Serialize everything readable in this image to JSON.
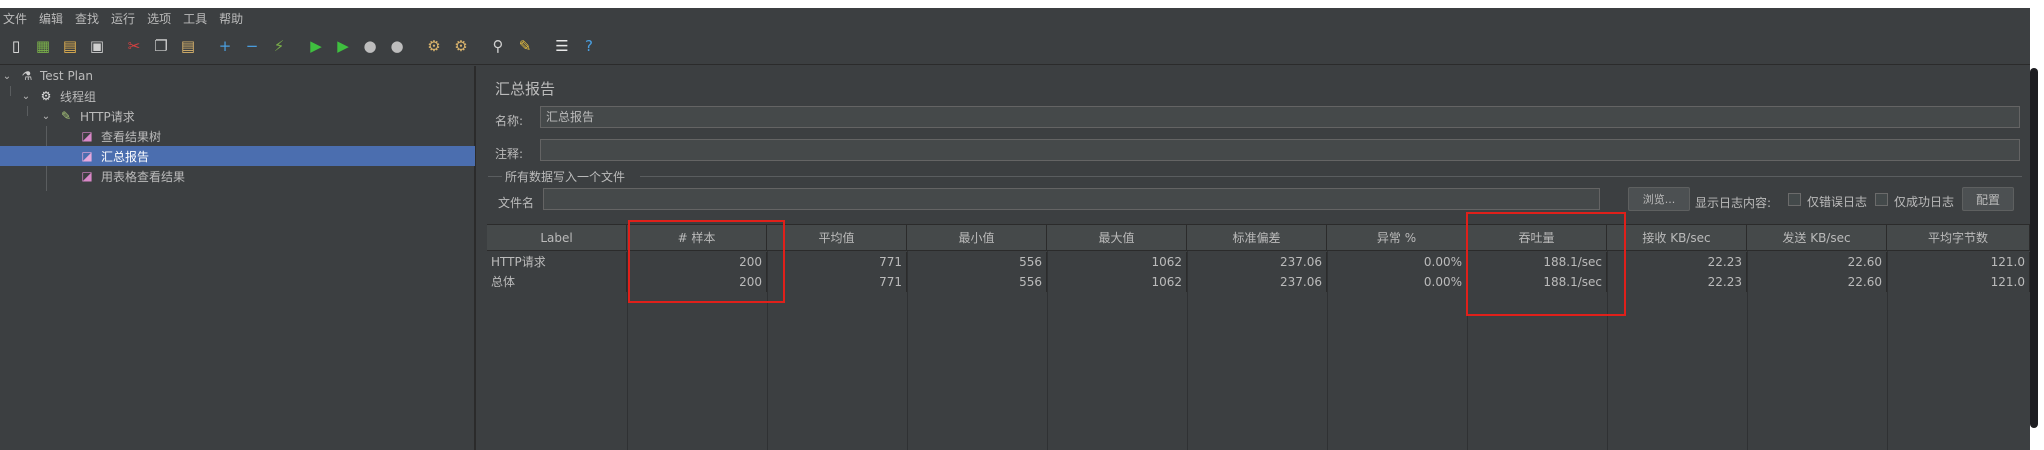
{
  "menu": [
    "文件",
    "编辑",
    "查找",
    "运行",
    "选项",
    "工具",
    "帮助"
  ],
  "toolbar_icons": [
    {
      "name": "new-icon",
      "glyph": "▯",
      "color": "#e8e8e8"
    },
    {
      "name": "templates-icon",
      "glyph": "▦",
      "color": "#7ab04a"
    },
    {
      "name": "open-icon",
      "glyph": "▤",
      "color": "#e0b050"
    },
    {
      "name": "save-icon",
      "glyph": "▣",
      "color": "#cfcfcf"
    },
    {
      "name": "cut-icon",
      "glyph": "✂",
      "color": "#d94040"
    },
    {
      "name": "copy-icon",
      "glyph": "❐",
      "color": "#cfcfcf"
    },
    {
      "name": "paste-icon",
      "glyph": "▤",
      "color": "#d9b36c"
    },
    {
      "name": "expand-icon",
      "glyph": "+",
      "color": "#4a9fe0"
    },
    {
      "name": "collapse-icon",
      "glyph": "−",
      "color": "#4a9fe0"
    },
    {
      "name": "toggle-icon",
      "glyph": "⚡",
      "color": "#7ab04a"
    },
    {
      "name": "start-icon",
      "glyph": "▶",
      "color": "#3fbf3f"
    },
    {
      "name": "start-no-pauses-icon",
      "glyph": "▶",
      "color": "#3fbf3f"
    },
    {
      "name": "stop-icon",
      "glyph": "●",
      "color": "#bdbdbd"
    },
    {
      "name": "shutdown-icon",
      "glyph": "●",
      "color": "#bdbdbd"
    },
    {
      "name": "clear-icon",
      "glyph": "⚙",
      "color": "#d9b36c"
    },
    {
      "name": "clear-all-icon",
      "glyph": "⚙",
      "color": "#d9b36c"
    },
    {
      "name": "search-icon",
      "glyph": "⚲",
      "color": "#cfcfcf"
    },
    {
      "name": "reset-search-icon",
      "glyph": "✎",
      "color": "#e8c040"
    },
    {
      "name": "function-helper-icon",
      "glyph": "☰",
      "color": "#e8e8e8"
    },
    {
      "name": "help-icon",
      "glyph": "?",
      "color": "#4a9fe0"
    }
  ],
  "tree": [
    {
      "label": "Test Plan",
      "icon": "flask-icon",
      "glyph": "⚗"
    },
    {
      "label": "线程组",
      "icon": "gear-icon",
      "glyph": "⚙"
    },
    {
      "label": "HTTP请求",
      "icon": "pipette-icon",
      "glyph": "✎"
    },
    {
      "label": "查看结果树",
      "icon": "graph-icon",
      "glyph": "◪"
    },
    {
      "label": "汇总报告",
      "icon": "graph-icon",
      "glyph": "◪"
    },
    {
      "label": "用表格查看结果",
      "icon": "graph-icon",
      "glyph": "◪"
    }
  ],
  "panel": {
    "title": "汇总报告",
    "name_label": "名称:",
    "name_value": "汇总报告",
    "comment_label": "注释:",
    "comment_value": "",
    "group_title": "所有数据写入一个文件",
    "file_label": "文件名",
    "file_value": "",
    "browse_button": "浏览...",
    "log_label": "显示日志内容:",
    "errors_only": "仅错误日志",
    "success_only": "仅成功日志",
    "config_button": "配置"
  },
  "table": {
    "headers": [
      "Label",
      "# 样本",
      "平均值",
      "最小值",
      "最大值",
      "标准偏差",
      "异常 %",
      "吞吐量",
      "接收 KB/sec",
      "发送 KB/sec",
      "平均字节数"
    ],
    "rows": [
      [
        "HTTP请求",
        "200",
        "771",
        "556",
        "1062",
        "237.06",
        "0.00%",
        "188.1/sec",
        "22.23",
        "22.60",
        "121.0"
      ],
      [
        "总体",
        "200",
        "771",
        "556",
        "1062",
        "237.06",
        "0.00%",
        "188.1/sec",
        "22.23",
        "22.60",
        "121.0"
      ]
    ]
  },
  "highlight_color": "#e0201a"
}
